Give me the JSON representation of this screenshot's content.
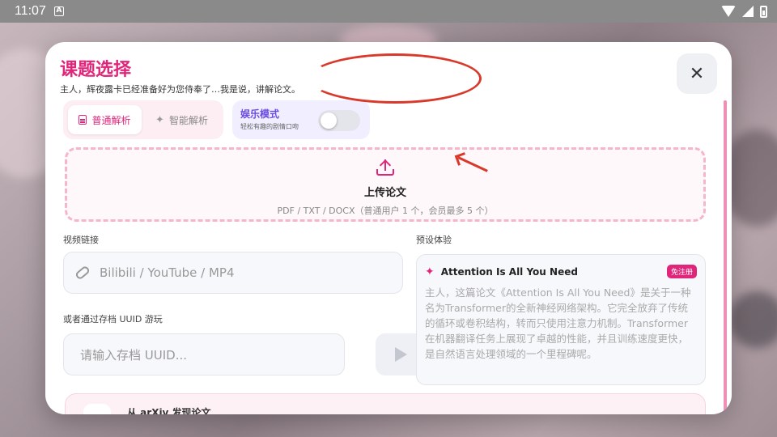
{
  "statusbar": {
    "time": "11:07"
  },
  "modal": {
    "title": "课题选择",
    "subtitle": "主人，辉夜露卡已经准备好为您侍奉了…我是说，讲解论文。",
    "close_label": "✕"
  },
  "modes": {
    "normal_label": "普通解析",
    "smart_label": "智能解析",
    "selected": "普通解析"
  },
  "entertainment": {
    "title": "娱乐模式",
    "desc": "轻松有趣的剧情口吻",
    "enabled": false
  },
  "upload": {
    "title": "上传论文",
    "desc": "PDF / TXT / DOCX（普通用户 1 个，会员最多 5 个）"
  },
  "video": {
    "label": "视频链接",
    "placeholder": "Bilibili / YouTube / MP4"
  },
  "archive": {
    "label": "或者通过存档 UUID 游玩",
    "placeholder": "请输入存档 UUID..."
  },
  "preset": {
    "label": "预设体验",
    "title": "Attention Is All You Need",
    "badge": "免注册",
    "body": "主人，这篇论文《Attention Is All You Need》是关于一种名为Transformer的全新神经网络架构。它完全放弃了传统的循环或卷积结构，转而只使用注意力机制。Transformer在机器翻译任务上展现了卓越的性能，并且训练速度更快，是自然语言处理领域的一个里程碑呢。"
  },
  "arxiv": {
    "title": "从 arXiv 发现论文"
  },
  "colors": {
    "accent": "#e0267a",
    "purple": "#6b4ce0",
    "annotation": "#d9392b"
  }
}
